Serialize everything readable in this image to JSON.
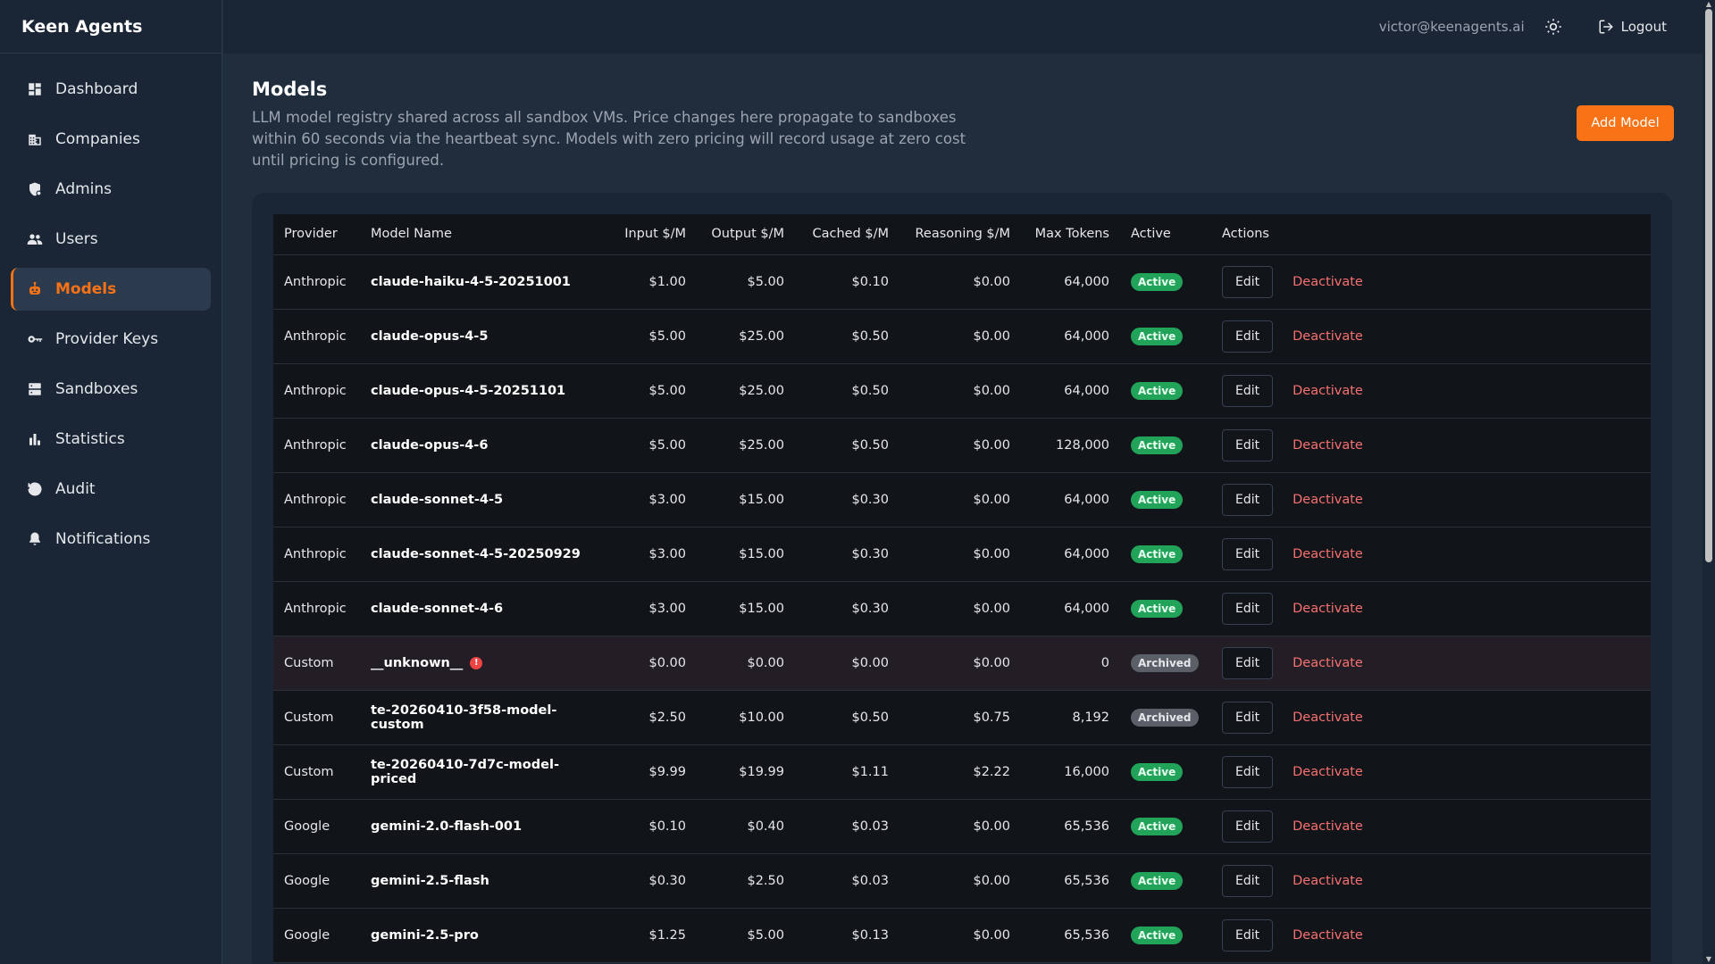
{
  "app": {
    "title": "Keen Agents"
  },
  "sidebar": {
    "items": [
      {
        "label": "Dashboard",
        "icon": "dashboard-icon",
        "active": false
      },
      {
        "label": "Companies",
        "icon": "building-icon",
        "active": false
      },
      {
        "label": "Admins",
        "icon": "admin-shield-icon",
        "active": false
      },
      {
        "label": "Users",
        "icon": "users-icon",
        "active": false
      },
      {
        "label": "Models",
        "icon": "robot-icon",
        "active": true
      },
      {
        "label": "Provider Keys",
        "icon": "key-icon",
        "active": false
      },
      {
        "label": "Sandboxes",
        "icon": "server-icon",
        "active": false
      },
      {
        "label": "Statistics",
        "icon": "bar-chart-icon",
        "active": false
      },
      {
        "label": "Audit",
        "icon": "history-icon",
        "active": false
      },
      {
        "label": "Notifications",
        "icon": "bell-icon",
        "active": false
      }
    ]
  },
  "topbar": {
    "user_email": "victor@keenagents.ai",
    "theme_icon": "sun-icon",
    "logout_label": "Logout"
  },
  "page": {
    "title": "Models",
    "description": "LLM model registry shared across all sandbox VMs. Price changes here propagate to sandboxes within 60 seconds via the heartbeat sync. Models with zero pricing will record usage at zero cost until pricing is configured.",
    "add_button": "Add Model"
  },
  "table": {
    "columns": [
      "Provider",
      "Model Name",
      "Input $/M",
      "Output $/M",
      "Cached $/M",
      "Reasoning $/M",
      "Max Tokens",
      "Active",
      "Actions"
    ],
    "edit_label": "Edit",
    "deactivate_label": "Deactivate",
    "rows": [
      {
        "provider": "Anthropic",
        "model": "claude-haiku-4-5-20251001",
        "input": "$1.00",
        "output": "$5.00",
        "cached": "$0.10",
        "reasoning": "$0.00",
        "max_tokens": "64,000",
        "status": "Active",
        "warning": false
      },
      {
        "provider": "Anthropic",
        "model": "claude-opus-4-5",
        "input": "$5.00",
        "output": "$25.00",
        "cached": "$0.50",
        "reasoning": "$0.00",
        "max_tokens": "64,000",
        "status": "Active",
        "warning": false
      },
      {
        "provider": "Anthropic",
        "model": "claude-opus-4-5-20251101",
        "input": "$5.00",
        "output": "$25.00",
        "cached": "$0.50",
        "reasoning": "$0.00",
        "max_tokens": "64,000",
        "status": "Active",
        "warning": false
      },
      {
        "provider": "Anthropic",
        "model": "claude-opus-4-6",
        "input": "$5.00",
        "output": "$25.00",
        "cached": "$0.50",
        "reasoning": "$0.00",
        "max_tokens": "128,000",
        "status": "Active",
        "warning": false
      },
      {
        "provider": "Anthropic",
        "model": "claude-sonnet-4-5",
        "input": "$3.00",
        "output": "$15.00",
        "cached": "$0.30",
        "reasoning": "$0.00",
        "max_tokens": "64,000",
        "status": "Active",
        "warning": false
      },
      {
        "provider": "Anthropic",
        "model": "claude-sonnet-4-5-20250929",
        "input": "$3.00",
        "output": "$15.00",
        "cached": "$0.30",
        "reasoning": "$0.00",
        "max_tokens": "64,000",
        "status": "Active",
        "warning": false
      },
      {
        "provider": "Anthropic",
        "model": "claude-sonnet-4-6",
        "input": "$3.00",
        "output": "$15.00",
        "cached": "$0.30",
        "reasoning": "$0.00",
        "max_tokens": "64,000",
        "status": "Active",
        "warning": false
      },
      {
        "provider": "Custom",
        "model": "__unknown__",
        "input": "$0.00",
        "output": "$0.00",
        "cached": "$0.00",
        "reasoning": "$0.00",
        "max_tokens": "0",
        "status": "Archived",
        "warning": true
      },
      {
        "provider": "Custom",
        "model": "te-20260410-3f58-model-custom",
        "input": "$2.50",
        "output": "$10.00",
        "cached": "$0.50",
        "reasoning": "$0.75",
        "max_tokens": "8,192",
        "status": "Archived",
        "warning": false
      },
      {
        "provider": "Custom",
        "model": "te-20260410-7d7c-model-priced",
        "input": "$9.99",
        "output": "$19.99",
        "cached": "$1.11",
        "reasoning": "$2.22",
        "max_tokens": "16,000",
        "status": "Active",
        "warning": false
      },
      {
        "provider": "Google",
        "model": "gemini-2.0-flash-001",
        "input": "$0.10",
        "output": "$0.40",
        "cached": "$0.03",
        "reasoning": "$0.00",
        "max_tokens": "65,536",
        "status": "Active",
        "warning": false
      },
      {
        "provider": "Google",
        "model": "gemini-2.5-flash",
        "input": "$0.30",
        "output": "$2.50",
        "cached": "$0.03",
        "reasoning": "$0.00",
        "max_tokens": "65,536",
        "status": "Active",
        "warning": false
      },
      {
        "provider": "Google",
        "model": "gemini-2.5-pro",
        "input": "$1.25",
        "output": "$5.00",
        "cached": "$0.13",
        "reasoning": "$0.00",
        "max_tokens": "65,536",
        "status": "Active",
        "warning": false
      }
    ]
  },
  "colors": {
    "accent": "#f97316",
    "active_badge": "#22a35a",
    "archived_badge": "#5b6068",
    "danger": "#f87171"
  }
}
